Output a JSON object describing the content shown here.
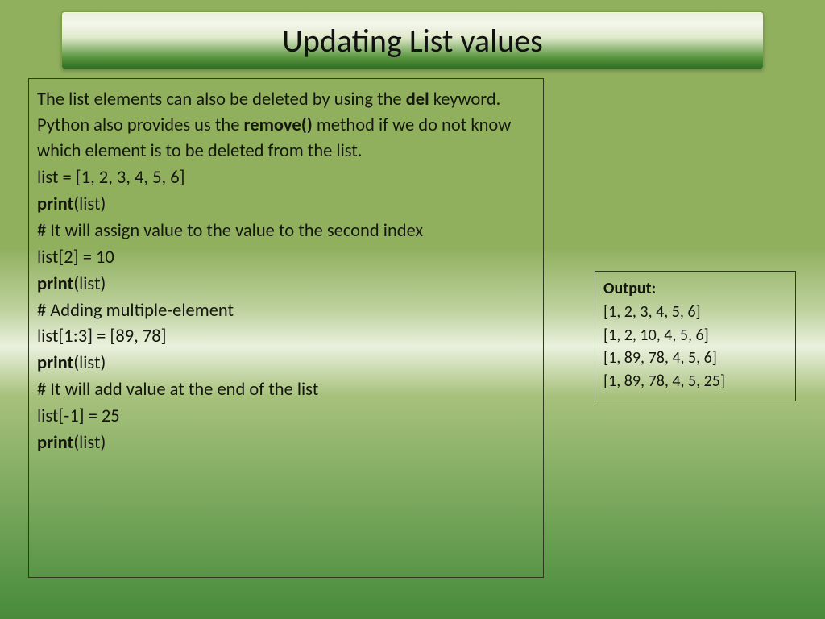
{
  "title": "Updating List values",
  "intro": {
    "part1": "The list elements can also be deleted by using the ",
    "bold1": "del",
    "part2": " keyword. Python also provides us the ",
    "bold2": "remove()",
    "part3": " method if we do not know which element is to be deleted from the list."
  },
  "code": {
    "line1": "list = [1, 2, 3, 4, 5, 6]",
    "print_kw": "print",
    "print_args": "(list)",
    "comment1": "# It will assign value to the value to the second index",
    "line3": "list[2] = 10",
    "comment2": "# Adding multiple-element",
    "line5": "list[1:3] = [89, 78]",
    "comment3": "# It will add value at the end of the list",
    "line7": "list[-1] = 25"
  },
  "output": {
    "label": "Output:",
    "lines": {
      "l1": "[1, 2, 3, 4, 5, 6]",
      "l2": " [1, 2, 10, 4, 5, 6]",
      "l3": " [1, 89, 78, 4, 5, 6]",
      "l4": " [1, 89, 78, 4, 5, 25]"
    }
  }
}
